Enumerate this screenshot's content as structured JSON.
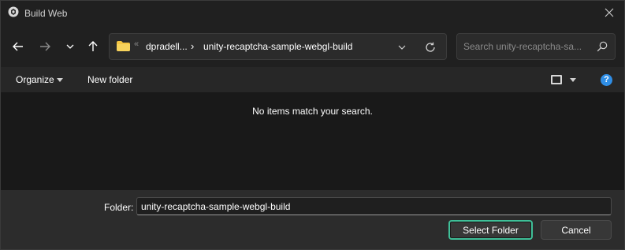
{
  "window": {
    "title": "Build Web"
  },
  "nav": {
    "back_icon": "arrow-left-icon",
    "forward_icon": "arrow-right-icon",
    "recent_icon": "chevron-down-icon",
    "up_icon": "arrow-up-icon"
  },
  "address": {
    "overflow": "«",
    "crumbs": [
      {
        "label": "dpradell..."
      },
      {
        "label": "unity-recaptcha-sample-webgl-build"
      }
    ],
    "separator": "›"
  },
  "search": {
    "placeholder": "Search unity-recaptcha-sa..."
  },
  "toolbar": {
    "organize_label": "Organize",
    "new_folder_label": "New folder",
    "help_label": "?"
  },
  "content": {
    "empty_message": "No items match your search."
  },
  "footer": {
    "folder_label": "Folder:",
    "folder_value": "unity-recaptcha-sample-webgl-build",
    "select_label": "Select Folder",
    "cancel_label": "Cancel"
  },
  "colors": {
    "accent": "#3fbf98",
    "folder_yellow": "#f4c542",
    "help_blue": "#2f8ee6",
    "background": "#202020"
  }
}
